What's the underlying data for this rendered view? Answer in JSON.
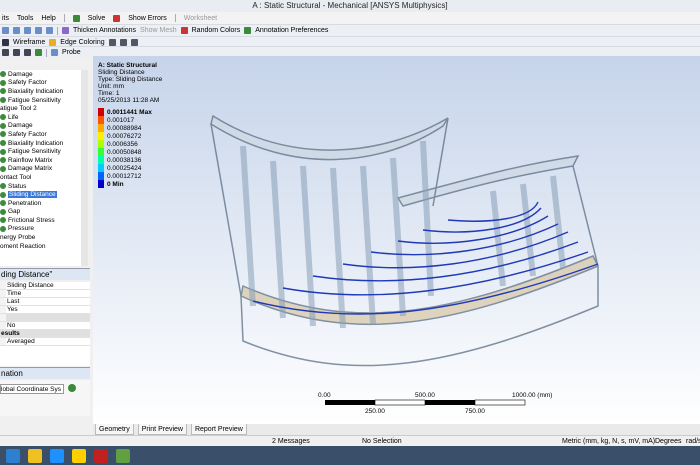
{
  "window": {
    "title": "A : Static Structural - Mechanical [ANSYS Multiphysics]"
  },
  "menu": [
    "its",
    "Tools",
    "Help"
  ],
  "toolbar1": {
    "solve": "Solve",
    "show_errors": "Show Errors",
    "worksheet": "Worksheet"
  },
  "toolbar2": {
    "thicken": "Thicken Annotations",
    "show_mesh": "Show Mesh",
    "random_colors": "Random Colors",
    "annotation_prefs": "Annotation Preferences"
  },
  "toolbar3": {
    "wireframe": "Wireframe",
    "edge_coloring": "Edge Coloring",
    "probe": "Probe"
  },
  "tree": [
    "Damage",
    "Safety Factor",
    "Biaxiality Indication",
    "Fatigue Sensitivity",
    "atigue Tool 2",
    "Life",
    "Damage",
    "Safety Factor",
    "Biaxiality Indication",
    "Fatigue Sensitivity",
    "Rainflow Matrix",
    "Damage Matrix",
    "ontact Tool",
    "Status",
    "Sliding Distance",
    "Penetration",
    "Gap",
    "Frictional Stress",
    "Pressure",
    "nergy Probe",
    "oment Reaction"
  ],
  "tree_selected": 14,
  "details_header": "ding Distance\"",
  "details_rows": [
    {
      "text": "Sliding Distance",
      "section": false
    },
    {
      "text": "Time",
      "section": false
    },
    {
      "text": "Last",
      "section": false
    },
    {
      "text": "Yes",
      "section": false
    },
    {
      "text": "",
      "section": true
    },
    {
      "text": "No",
      "section": false
    },
    {
      "text": "esults",
      "section": true
    },
    {
      "text": "Averaged",
      "section": false
    }
  ],
  "orientation_header": "nation",
  "orientation_field": "lobal Coordinate Sys",
  "viewport": {
    "title": "A: Static Structural",
    "subtitle": "Sliding Distance",
    "type": "Type: Sliding Distance",
    "unit": "Unit: mm",
    "time": "Time: 1",
    "date": "05/25/2013 11:28 AM",
    "legend": [
      {
        "value": "0.0011441 Max",
        "color": "#d00000",
        "bold": true
      },
      {
        "value": "0.001017",
        "color": "#ff5500",
        "bold": false
      },
      {
        "value": "0.00088984",
        "color": "#ffaa00",
        "bold": false
      },
      {
        "value": "0.00076272",
        "color": "#ffee00",
        "bold": false
      },
      {
        "value": "0.0006356",
        "color": "#aaff00",
        "bold": false
      },
      {
        "value": "0.00050848",
        "color": "#33ff33",
        "bold": false
      },
      {
        "value": "0.00038136",
        "color": "#00ffaa",
        "bold": false
      },
      {
        "value": "0.00025424",
        "color": "#00ccff",
        "bold": false
      },
      {
        "value": "0.00012712",
        "color": "#0066ff",
        "bold": false
      },
      {
        "value": "0 Min",
        "color": "#0000cc",
        "bold": true
      }
    ],
    "scale_top": [
      "0.00",
      "500.00",
      "1000.00 (mm)"
    ],
    "scale_bottom": [
      "250.00",
      "750.00"
    ]
  },
  "bottom_tabs": [
    "Geometry",
    "Print Preview",
    "Report Preview"
  ],
  "status": {
    "messages": "2 Messages",
    "selection": "No Selection",
    "units": "Metric (mm, kg, N, s, mV, mA)",
    "angle": "Degrees",
    "rate": "rad/s"
  },
  "colors": {
    "accent": "#3b78d8",
    "viewport_top": "#c6d4ea",
    "taskbar": "#3a4f6a"
  }
}
